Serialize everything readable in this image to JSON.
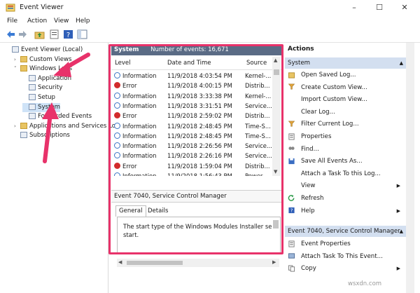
{
  "window": {
    "title": "Event Viewer",
    "controls": [
      "–",
      "☐",
      "✕"
    ]
  },
  "menu": [
    "File",
    "Action",
    "View",
    "Help"
  ],
  "tree": {
    "items": [
      {
        "label": "Event Viewer (Local)",
        "indent": 0,
        "expander": "",
        "icon": "event-viewer-icon"
      },
      {
        "label": "Custom Views",
        "indent": 1,
        "expander": "›",
        "icon": "folder-icon"
      },
      {
        "label": "Windows Logs",
        "indent": 1,
        "expander": "˅",
        "icon": "folder-icon"
      },
      {
        "label": "Application",
        "indent": 2,
        "expander": "",
        "icon": "log-icon"
      },
      {
        "label": "Security",
        "indent": 2,
        "expander": "",
        "icon": "log-icon"
      },
      {
        "label": "Setup",
        "indent": 2,
        "expander": "",
        "icon": "log-icon"
      },
      {
        "label": "System",
        "indent": 2,
        "expander": "",
        "icon": "log-icon"
      },
      {
        "label": "Forwarded Events",
        "indent": 2,
        "expander": "",
        "icon": "log-icon"
      },
      {
        "label": "Applications and Services Lo",
        "indent": 1,
        "expander": "›",
        "icon": "folder-icon"
      },
      {
        "label": "Subscriptions",
        "indent": 1,
        "expander": "",
        "icon": "log-icon"
      }
    ]
  },
  "center": {
    "header_title": "System",
    "header_count": "Number of events: 16,671",
    "columns": [
      "Level",
      "Date and Time",
      "Source"
    ],
    "rows": [
      {
        "level": "Information",
        "type": "info",
        "date": "11/9/2018 4:03:54 PM",
        "source": "Kernel-..."
      },
      {
        "level": "Error",
        "type": "error",
        "date": "11/9/2018 4:00:15 PM",
        "source": "Distrib..."
      },
      {
        "level": "Information",
        "type": "info",
        "date": "11/9/2018 3:33:38 PM",
        "source": "Kernel-..."
      },
      {
        "level": "Information",
        "type": "info",
        "date": "11/9/2018 3:31:51 PM",
        "source": "Service..."
      },
      {
        "level": "Error",
        "type": "error",
        "date": "11/9/2018 2:59:02 PM",
        "source": "Distrib..."
      },
      {
        "level": "Information",
        "type": "info",
        "date": "11/9/2018 2:48:45 PM",
        "source": "Time-S..."
      },
      {
        "level": "Information",
        "type": "info",
        "date": "11/9/2018 2:48:45 PM",
        "source": "Time-S..."
      },
      {
        "level": "Information",
        "type": "info",
        "date": "11/9/2018 2:26:56 PM",
        "source": "Service..."
      },
      {
        "level": "Information",
        "type": "info",
        "date": "11/9/2018 2:26:16 PM",
        "source": "Service..."
      },
      {
        "level": "Error",
        "type": "error",
        "date": "11/9/2018 1:59:04 PM",
        "source": "Distrib..."
      },
      {
        "level": "Information",
        "type": "info",
        "date": "11/9/2018 1:56:43 PM",
        "source": "Power-..."
      }
    ],
    "detail_title": "Event 7040, Service Control Manager",
    "tabs": [
      "General",
      "Details"
    ],
    "detail_text_line1": "The start type of the Windows Modules Installer se",
    "detail_text_line2": "start."
  },
  "actions": {
    "title": "Actions",
    "section1": "System",
    "items1": [
      {
        "label": "Open Saved Log...",
        "icon": "open-log-icon",
        "arrow": ""
      },
      {
        "label": "Create Custom View...",
        "icon": "filter-icon",
        "arrow": ""
      },
      {
        "label": "Import Custom View...",
        "icon": "",
        "arrow": ""
      },
      {
        "label": "Clear Log...",
        "icon": "",
        "arrow": ""
      },
      {
        "label": "Filter Current Log...",
        "icon": "filter-icon",
        "arrow": ""
      },
      {
        "label": "Properties",
        "icon": "properties-icon",
        "arrow": ""
      },
      {
        "label": "Find...",
        "icon": "find-icon",
        "arrow": ""
      },
      {
        "label": "Save All Events As...",
        "icon": "save-icon",
        "arrow": ""
      },
      {
        "label": "Attach a Task To this Log...",
        "icon": "",
        "arrow": ""
      },
      {
        "label": "View",
        "icon": "",
        "arrow": "▶"
      },
      {
        "label": "Refresh",
        "icon": "refresh-icon",
        "arrow": ""
      },
      {
        "label": "Help",
        "icon": "help-icon",
        "arrow": "▶"
      }
    ],
    "section2": "Event 7040, Service Control Manager",
    "items2": [
      {
        "label": "Event Properties",
        "icon": "properties-icon",
        "arrow": ""
      },
      {
        "label": "Attach Task To This Event...",
        "icon": "task-icon",
        "arrow": ""
      },
      {
        "label": "Copy",
        "icon": "copy-icon",
        "arrow": "▶"
      }
    ]
  },
  "watermark": "wsxdn.com",
  "colors": {
    "highlight_border": "#e8326a",
    "arrow": "#e8326a",
    "header_bar": "#5a6b85",
    "section_bg": "#d3dff0",
    "error": "#d22b2b"
  }
}
